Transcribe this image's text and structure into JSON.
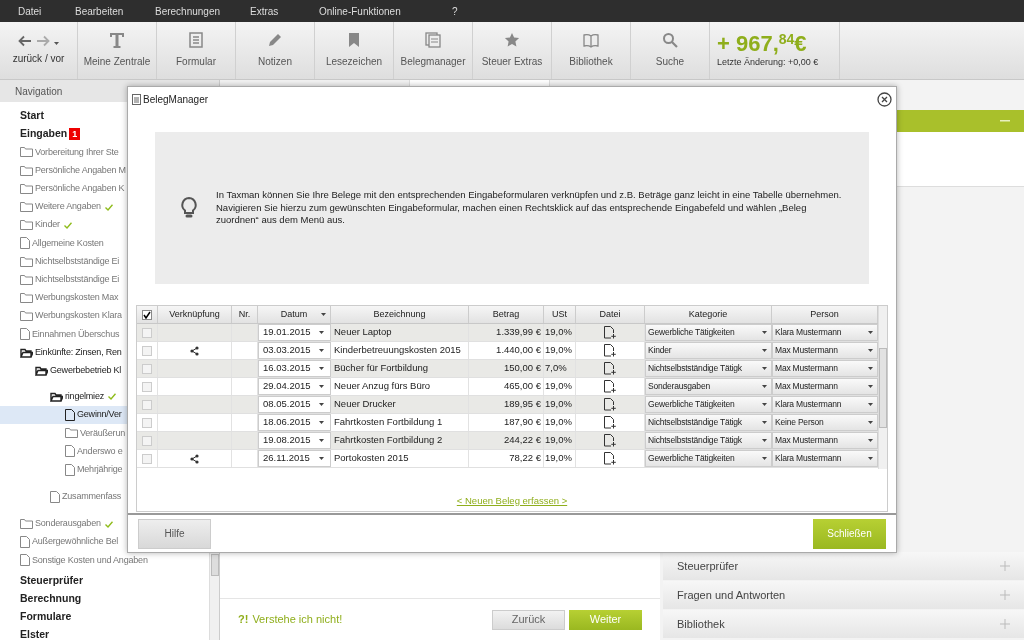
{
  "menu": [
    "Datei",
    "Bearbeiten",
    "Berechnungen",
    "Extras",
    "Online-Funktionen",
    "?"
  ],
  "toolbar": {
    "nav_label": "zurück / vor",
    "buttons": [
      {
        "label": "Meine Zentrale",
        "kind": "text"
      },
      {
        "label": "Formular",
        "kind": "form"
      },
      {
        "label": "Notizen",
        "kind": "pencil"
      },
      {
        "label": "Lesezeichen",
        "kind": "bookmark"
      },
      {
        "label": "Belegmanager",
        "kind": "docs"
      },
      {
        "label": "Steuer Extras",
        "kind": "star"
      },
      {
        "label": "Bibliothek",
        "kind": "book"
      },
      {
        "label": "Suche",
        "kind": "search"
      }
    ]
  },
  "balance": {
    "amount": "+ 967,$^{84}$€",
    "note": "Letzte Änderung: +0,00 €"
  },
  "navigation": {
    "title": "Navigation",
    "items": [
      {
        "label": "Start",
        "kind": "section",
        "done": false,
        "selected": false
      },
      {
        "label": "Eingaben",
        "kind": "section",
        "badge": "1",
        "done": false,
        "selected": false,
        "children": [
          {
            "label": "Vorbereitung Ihrer Ste",
            "kind": "folder",
            "selected": false
          },
          {
            "label": "Persönliche Angaben M",
            "kind": "folder",
            "selected": false
          },
          {
            "label": "Persönliche Angaben K",
            "kind": "folder",
            "selected": false
          },
          {
            "label": "Weitere Angaben",
            "kind": "folder",
            "done": true,
            "selected": false
          },
          {
            "label": "Kinder",
            "kind": "folder",
            "done": true,
            "selected": false
          },
          {
            "label": "Allgemeine Kosten",
            "kind": "file",
            "done": false,
            "selected": false
          },
          {
            "label": "Nichtselbstständige Ei",
            "kind": "folder",
            "selected": false
          },
          {
            "label": "Nichtselbstständige Ei",
            "kind": "folder",
            "selected": false
          },
          {
            "label": "Werbungskosten Max",
            "kind": "folder",
            "selected": false
          },
          {
            "label": "Werbungskosten Klara",
            "kind": "folder",
            "selected": false
          },
          {
            "label": "Einnahmen Überschus",
            "kind": "file",
            "selected": false
          },
          {
            "label": "Einkünfte: Zinsen, Ren",
            "kind": "open-folder",
            "selected": false,
            "children": [
              {
                "label": "Gewerbebetrieb Kl",
                "kind": "open-folder",
                "selected": false,
                "children": [
                  {
                    "label": "ringelmiez",
                    "kind": "open-folder",
                    "done": true,
                    "selected": false,
                    "children": [
                      {
                        "label": "Gewinn/Ver",
                        "kind": "file",
                        "selected": true
                      },
                      {
                        "label": "Veräußerun",
                        "kind": "folder",
                        "selected": false
                      },
                      {
                        "label": "Anderswo e",
                        "kind": "file",
                        "selected": false
                      },
                      {
                        "label": "Mehrjährige",
                        "kind": "file",
                        "selected": false
                      }
                    ]
                  },
                  {
                    "label": "Zusammenfass",
                    "kind": "file",
                    "selected": false
                  }
                ]
              }
            ]
          },
          {
            "label": "Sonderausgaben",
            "kind": "folder",
            "done": true,
            "selected": false
          },
          {
            "label": "Außergewöhnliche Bel",
            "kind": "file",
            "selected": false
          },
          {
            "label": "Sonstige Kosten und Angaben",
            "kind": "file",
            "done": false,
            "selected": false
          }
        ]
      },
      {
        "label": "Steuerprüfer",
        "kind": "section",
        "done": false,
        "selected": false
      },
      {
        "label": "Berechnung",
        "kind": "section",
        "done": false,
        "selected": false
      },
      {
        "label": "Formulare",
        "kind": "section",
        "done": false,
        "selected": false
      },
      {
        "label": "Elster",
        "kind": "section",
        "done": false,
        "selected": false
      }
    ]
  },
  "main": {
    "hint_mark": "?!",
    "hint": "Verstehe ich nicht!",
    "back": "Zurück",
    "next": "Weiter"
  },
  "side_panel": {
    "sections": [
      "Steuerprüfer",
      "Fragen und Antworten",
      "Bibliothek"
    ]
  },
  "dialog": {
    "title": "BelegManager",
    "info": "In Taxman können Sie Ihre Belege mit den entsprechenden Eingabeformularen verknüpfen und z.B. Beträge ganz leicht in eine Tabelle übernehmen. Navigieren Sie hierzu zum gewünschten Eingabeformular, machen einen Rechtsklick auf das entsprechende Eingabefeld und wählen „Beleg zuordnen“ aus dem Menü aus.",
    "all_checked": true,
    "columns": [
      "Verknüpfung",
      "Nr.",
      "Datum",
      "Bezeichnung",
      "Betrag",
      "USt",
      "Datei",
      "Kategorie",
      "Person"
    ],
    "rows": [
      {
        "checked": false,
        "linked": false,
        "date": "19.01.2015",
        "name": "Neuer Laptop",
        "amount": "1.339,99 €",
        "vat": "19,0%",
        "category": "Gewerbliche Tätigkeiten",
        "person": "Klara Mustermann"
      },
      {
        "checked": false,
        "linked": true,
        "date": "03.03.2015",
        "name": "Kinderbetreuungskosten 2015",
        "amount": "1.440,00 €",
        "vat": "19,0%",
        "category": "Kinder",
        "person": "Max Mustermann"
      },
      {
        "checked": false,
        "linked": false,
        "date": "16.03.2015",
        "name": "Bücher für Fortbildung",
        "amount": "150,00 €",
        "vat": "7,0%",
        "category": "Nichtselbstständige Tätigk",
        "person": "Max Mustermann"
      },
      {
        "checked": false,
        "linked": false,
        "date": "29.04.2015",
        "name": "Neuer Anzug fürs Büro",
        "amount": "465,00 €",
        "vat": "19,0%",
        "category": "Sonderausgaben",
        "person": "Max Mustermann"
      },
      {
        "checked": false,
        "linked": false,
        "date": "08.05.2015",
        "name": "Neuer Drucker",
        "amount": "189,95 €",
        "vat": "19,0%",
        "category": "Gewerbliche Tätigkeiten",
        "person": "Klara Mustermann"
      },
      {
        "checked": false,
        "linked": false,
        "date": "18.06.2015",
        "name": "Fahrtkosten Fortbildung 1",
        "amount": "187,90 €",
        "vat": "19,0%",
        "category": "Nichtselbstständige Tätigk",
        "person": "Keine Person"
      },
      {
        "checked": false,
        "linked": false,
        "date": "19.08.2015",
        "name": "Fahrtkosten Fortbildung 2",
        "amount": "244,22 €",
        "vat": "19,0%",
        "category": "Nichtselbstständige Tätigk",
        "person": "Max Mustermann"
      },
      {
        "checked": false,
        "linked": true,
        "date": "26.11.2015",
        "name": "Portokosten 2015",
        "amount": "78,22 €",
        "vat": "19,0%",
        "category": "Gewerbliche Tätigkeiten",
        "person": "Klara Mustermann"
      }
    ],
    "new_link": "< Neuen Beleg erfassen >",
    "help": "Hilfe",
    "close": "Schließen"
  }
}
